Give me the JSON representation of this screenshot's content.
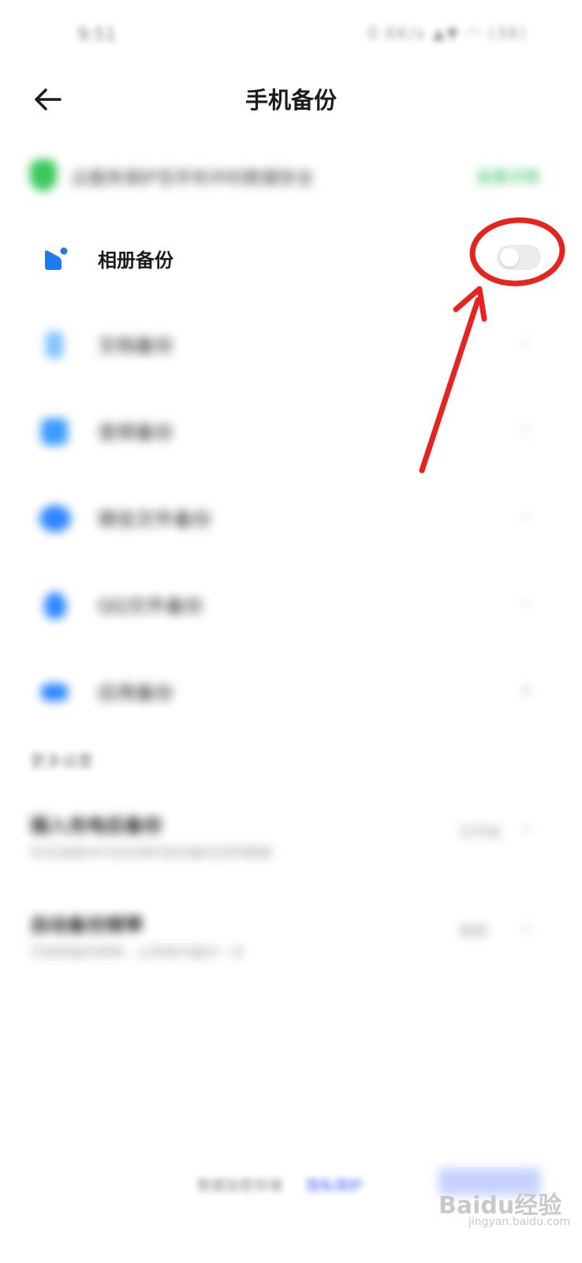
{
  "status_bar": {
    "time": "9:51",
    "right": "0.6K/s ▲▼ ◠ (36)"
  },
  "header": {
    "title": "手机备份",
    "back_icon": "arrow-left-icon"
  },
  "banner": {
    "text": "云服务保护您手机中的数据安全",
    "action": "查看详情"
  },
  "backup_items": [
    {
      "label": "相册备份",
      "icon": "album-icon",
      "control": "toggle",
      "enabled": false
    },
    {
      "label": "文档备份",
      "icon": "document-icon",
      "control": "chevron"
    },
    {
      "label": "音频备份",
      "icon": "audio-icon",
      "control": "chevron"
    },
    {
      "label": "微信文件备份",
      "icon": "wechat-icon",
      "control": "chevron"
    },
    {
      "label": "QQ文件备份",
      "icon": "qq-icon",
      "control": "chevron"
    },
    {
      "label": "应用备份",
      "icon": "app-icon",
      "control": "chevron"
    }
  ],
  "section": {
    "title": "更多设置"
  },
  "settings": [
    {
      "title": "插入充电后备份",
      "desc": "仅在连接WiFi且充电时自动备份您的数据",
      "value": "已开启"
    },
    {
      "title": "自动备份频率",
      "desc": "可选择备份频率，以及每天备份一次",
      "value": "每周"
    }
  ],
  "footer": {
    "text": "数据加密存储",
    "link": "隐私保护",
    "watermark": "Baidu经验",
    "watermark_sub": "jingyan.baidu.com"
  },
  "colors": {
    "accent": "#1e7bf0",
    "annotation": "#e8221f",
    "banner_green": "#39c95b"
  }
}
